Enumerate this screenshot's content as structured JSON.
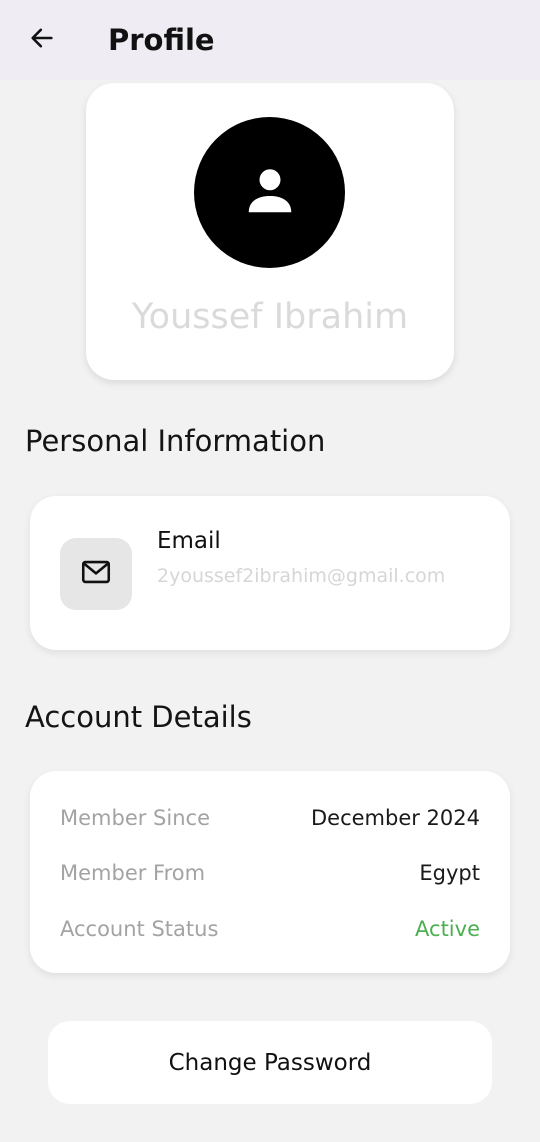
{
  "header": {
    "title": "Profile",
    "back_icon": "arrow-left-icon"
  },
  "profile": {
    "name": "Youssef Ibrahim",
    "avatar_icon": "person-icon"
  },
  "personal_information": {
    "title": "Personal Information",
    "email": {
      "icon": "mail-icon",
      "label": "Email",
      "value": "2youssef2ibrahim@gmail.com"
    }
  },
  "account_details": {
    "title": "Account Details",
    "rows": [
      {
        "label": "Member Since",
        "value": "December 2024"
      },
      {
        "label": "Member From",
        "value": "Egypt"
      },
      {
        "label": "Account Status",
        "value": "Active"
      }
    ],
    "status_color": "#4caf50"
  },
  "actions": {
    "change_password_label": "Change Password"
  }
}
